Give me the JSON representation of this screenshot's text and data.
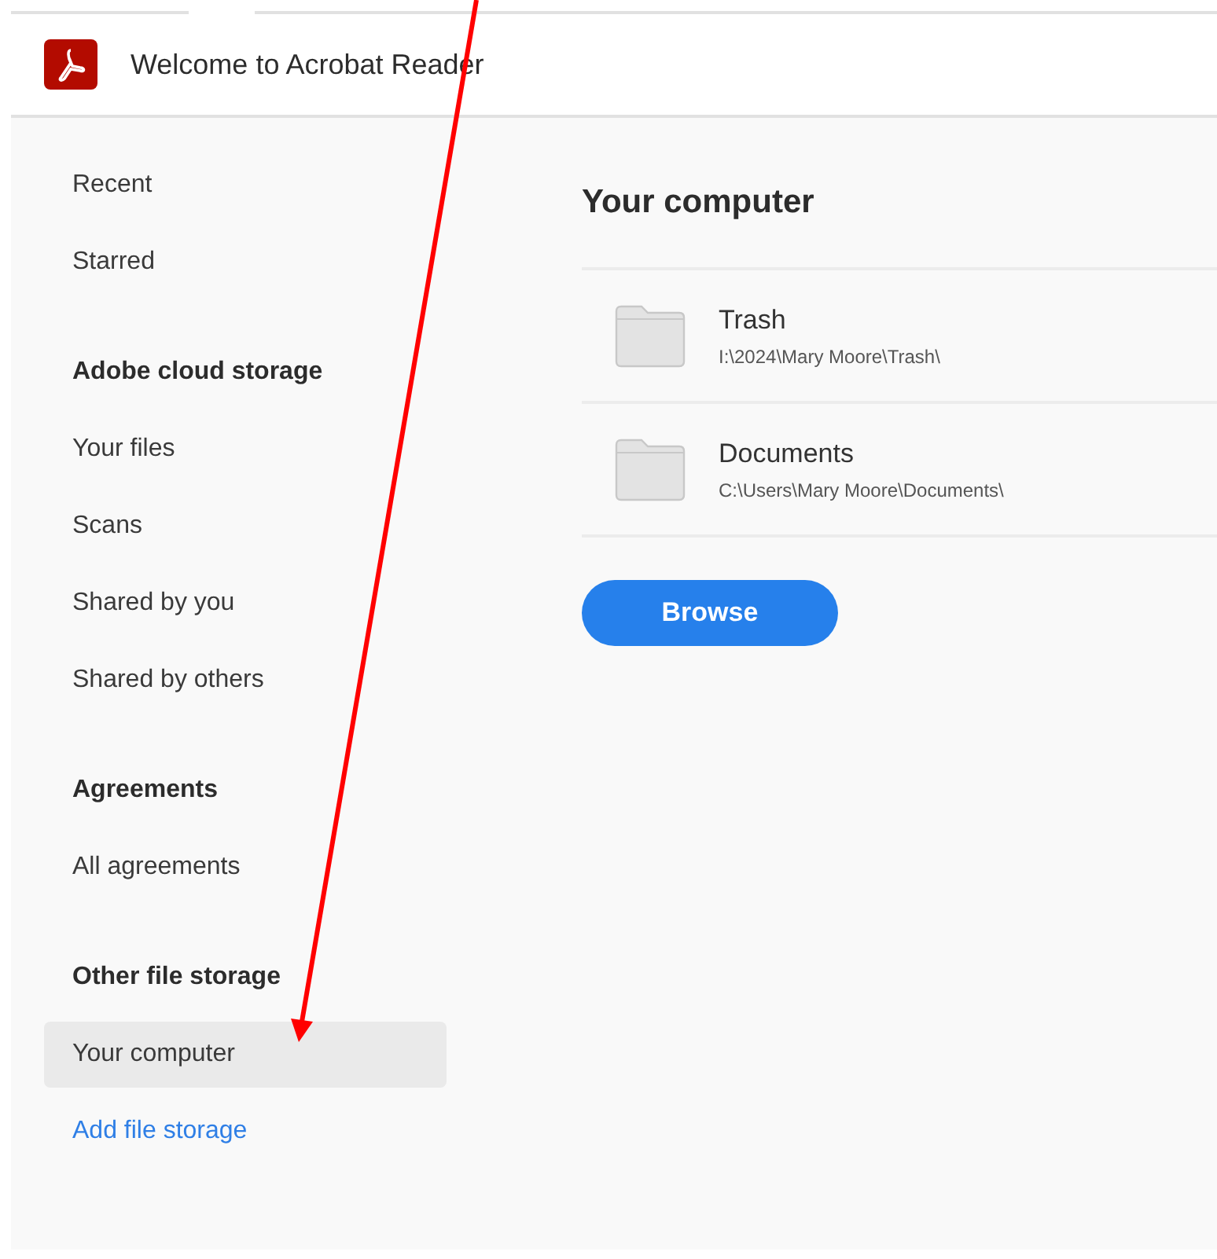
{
  "header": {
    "title": "Welcome to Acrobat Reader"
  },
  "sidebar": {
    "items": [
      {
        "kind": "item",
        "label": "Recent",
        "selected": false
      },
      {
        "kind": "item",
        "label": "Starred",
        "selected": false
      },
      {
        "kind": "heading",
        "label": "Adobe cloud storage"
      },
      {
        "kind": "item",
        "label": "Your files",
        "selected": false
      },
      {
        "kind": "item",
        "label": "Scans",
        "selected": false
      },
      {
        "kind": "item",
        "label": "Shared by you",
        "selected": false
      },
      {
        "kind": "item",
        "label": "Shared by others",
        "selected": false
      },
      {
        "kind": "heading",
        "label": "Agreements"
      },
      {
        "kind": "item",
        "label": "All agreements",
        "selected": false
      },
      {
        "kind": "heading",
        "label": "Other file storage"
      },
      {
        "kind": "item",
        "label": "Your computer",
        "selected": true
      },
      {
        "kind": "link",
        "label": "Add file storage"
      }
    ]
  },
  "main": {
    "title": "Your computer",
    "folders": [
      {
        "name": "Trash",
        "path": "I:\\2024\\Mary Moore\\Trash\\"
      },
      {
        "name": "Documents",
        "path": "C:\\Users\\Mary Moore\\Documents\\"
      }
    ],
    "button": "Browse"
  }
}
